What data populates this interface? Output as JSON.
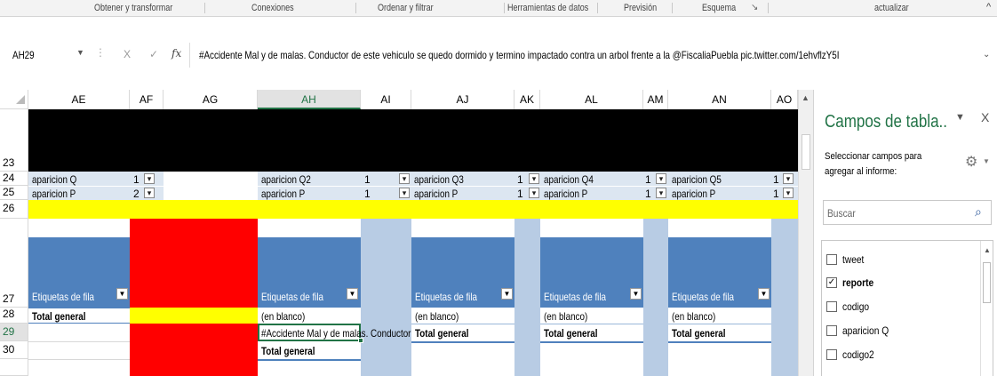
{
  "ribbon": {
    "groups": [
      "Obtener y transformar",
      "Conexiones",
      "Ordenar y filtrar",
      "Herramientas de datos",
      "Previsión",
      "Esquema",
      "actualizar"
    ]
  },
  "formula_bar": {
    "name_box": "AH29",
    "cancel_glyph": "X",
    "enter_glyph": "✓",
    "fx_label": "fx",
    "content": "#Accidente Mal y de malas. Conductor de este vehiculo se quedo dormido y termino impactado contra un arbol frente a la @FiscaliaPuebla pic.twitter.com/1ehvflzY5I"
  },
  "columns": [
    "AE",
    "AF",
    "AG",
    "AH",
    "AI",
    "AJ",
    "AK",
    "AL",
    "AM",
    "AN",
    "AO"
  ],
  "selected_column": "AH",
  "rows": [
    "23",
    "24",
    "25",
    "26",
    "27",
    "28",
    "29",
    "30"
  ],
  "selected_row": "29",
  "filters": {
    "ae": {
      "row24": {
        "label": "aparicion Q",
        "value": "1"
      },
      "row25": {
        "label": "aparicion P",
        "value": "2"
      }
    },
    "ah": {
      "row24": {
        "label": "aparicion Q2",
        "value": "1"
      },
      "row25": {
        "label": "aparicion P",
        "value": "1"
      }
    },
    "aj": {
      "row24": {
        "label": "aparicion Q3",
        "value": "1"
      },
      "row25": {
        "label": "aparicion P",
        "value": "1"
      }
    },
    "al": {
      "row24": {
        "label": "aparicion Q4",
        "value": "1"
      },
      "row25": {
        "label": "aparicion P",
        "value": "1"
      }
    },
    "an": {
      "row24": {
        "label": "aparicion Q5",
        "value": "1"
      },
      "row25": {
        "label": "aparicion P",
        "value": "1"
      }
    }
  },
  "pivots": {
    "row_labels_header": "Etiquetas de fila",
    "total": "Total general",
    "blank": "(en blanco)",
    "ah_row29": "#Accidente Mal y de malas. Conductor"
  },
  "field_pane": {
    "title": "Campos de tabla..",
    "close": "X",
    "instructions": "Seleccionar campos para agregar al informe:",
    "search_placeholder": "Buscar",
    "fields": [
      {
        "name": "tweet",
        "checked": false
      },
      {
        "name": "reporte",
        "checked": true
      },
      {
        "name": "codigo",
        "checked": false
      },
      {
        "name": "aparicion Q",
        "checked": false
      },
      {
        "name": "codigo2",
        "checked": false
      }
    ]
  },
  "colors": {
    "excel_green": "#217346",
    "pivot_header_blue": "#4f81bd",
    "light_blue": "#b8cce4",
    "red": "#ff0000",
    "yellow": "#ffff00"
  }
}
